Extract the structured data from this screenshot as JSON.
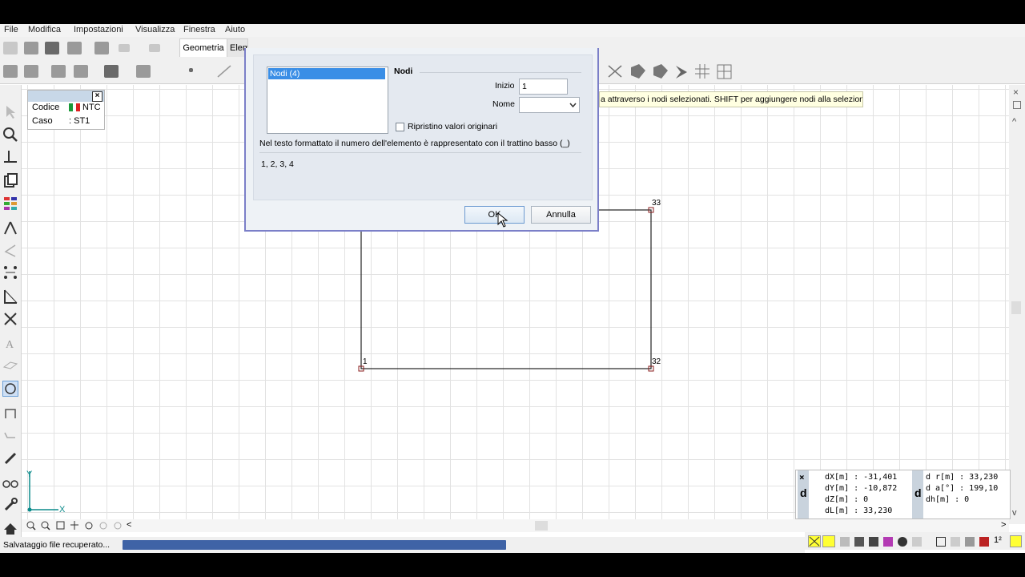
{
  "menu": {
    "items": [
      "File",
      "Modifica",
      "Impostazioni",
      "Visualizza",
      "Finestra",
      "Aiuto"
    ]
  },
  "toolbar": {
    "tab_geometria": "Geometria",
    "tab_elementi": "Elem"
  },
  "infobox": {
    "codice_label": "Codice",
    "codice_value": "NTC",
    "caso_label": "Caso",
    "caso_value": ": ST1"
  },
  "tooltip": "a attraverso i nodi selezionati. SHIFT per aggiungere nodi alla selezione.",
  "drawing": {
    "node_labels": [
      "33",
      "1",
      "32"
    ]
  },
  "axes": {
    "x": "X",
    "y": "Y"
  },
  "coords": {
    "col1": [
      "dX[m] : -31,401",
      "dY[m] : -10,872",
      "dZ[m] : 0",
      "dL[m] : 33,230"
    ],
    "col2": [
      "d r[m] : 33,230",
      "d a[°] : 199,10",
      "dh[m] : 0"
    ],
    "badge": "d"
  },
  "status": {
    "text": "Salvataggio file recuperato...",
    "progress": 0.62
  },
  "dialog": {
    "list_item": "Nodi (4)",
    "section_title": "Nodi",
    "inizio_label": "Inizio",
    "inizio_value": "1",
    "nome_label": "Nome",
    "nome_value": "",
    "ripristino_label": "Ripristino valori originari",
    "note": "Nel testo formattato il numero dell'elemento è rappresentato con il trattino basso (_)",
    "preview": "1, 2, 3, 4",
    "ok_label": "OK",
    "cancel_label": "Annulla"
  },
  "colors": {
    "dialog_border": "#7b7fc8",
    "selection": "#3a8ee6",
    "progress": "#3f63a6",
    "tooltip_bg": "#ffffe1"
  }
}
